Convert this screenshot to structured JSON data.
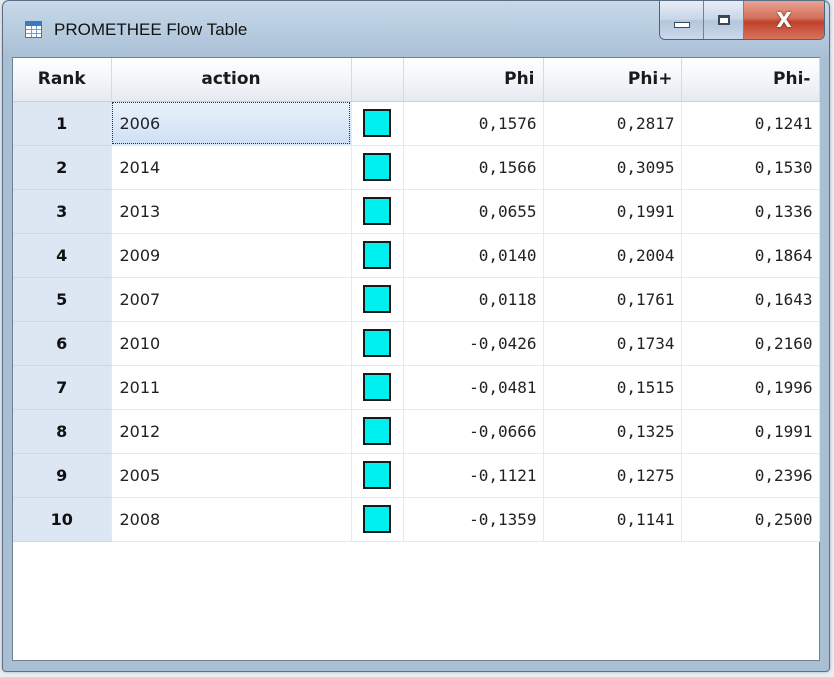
{
  "window": {
    "title": "PROMETHEE Flow Table"
  },
  "caption": {
    "minimize": "",
    "maximize": "",
    "close": "X"
  },
  "table": {
    "headers": {
      "rank": "Rank",
      "action": "action",
      "color": "",
      "phi": "Phi",
      "phi_plus": "Phi+",
      "phi_minus": "Phi-"
    },
    "swatch_color": "#00f0f0",
    "rows": [
      {
        "rank": "1",
        "action": "2006",
        "phi": "0,1576",
        "phi_plus": "0,2817",
        "phi_minus": "0,1241"
      },
      {
        "rank": "2",
        "action": "2014",
        "phi": "0,1566",
        "phi_plus": "0,3095",
        "phi_minus": "0,1530"
      },
      {
        "rank": "3",
        "action": "2013",
        "phi": "0,0655",
        "phi_plus": "0,1991",
        "phi_minus": "0,1336"
      },
      {
        "rank": "4",
        "action": "2009",
        "phi": "0,0140",
        "phi_plus": "0,2004",
        "phi_minus": "0,1864"
      },
      {
        "rank": "5",
        "action": "2007",
        "phi": "0,0118",
        "phi_plus": "0,1761",
        "phi_minus": "0,1643"
      },
      {
        "rank": "6",
        "action": "2010",
        "phi": "-0,0426",
        "phi_plus": "0,1734",
        "phi_minus": "0,2160"
      },
      {
        "rank": "7",
        "action": "2011",
        "phi": "-0,0481",
        "phi_plus": "0,1515",
        "phi_minus": "0,1996"
      },
      {
        "rank": "8",
        "action": "2012",
        "phi": "-0,0666",
        "phi_plus": "0,1325",
        "phi_minus": "0,1991"
      },
      {
        "rank": "9",
        "action": "2005",
        "phi": "-0,1121",
        "phi_plus": "0,1275",
        "phi_minus": "0,2396"
      },
      {
        "rank": "10",
        "action": "2008",
        "phi": "-0,1359",
        "phi_plus": "0,1141",
        "phi_minus": "0,2500"
      }
    ]
  }
}
